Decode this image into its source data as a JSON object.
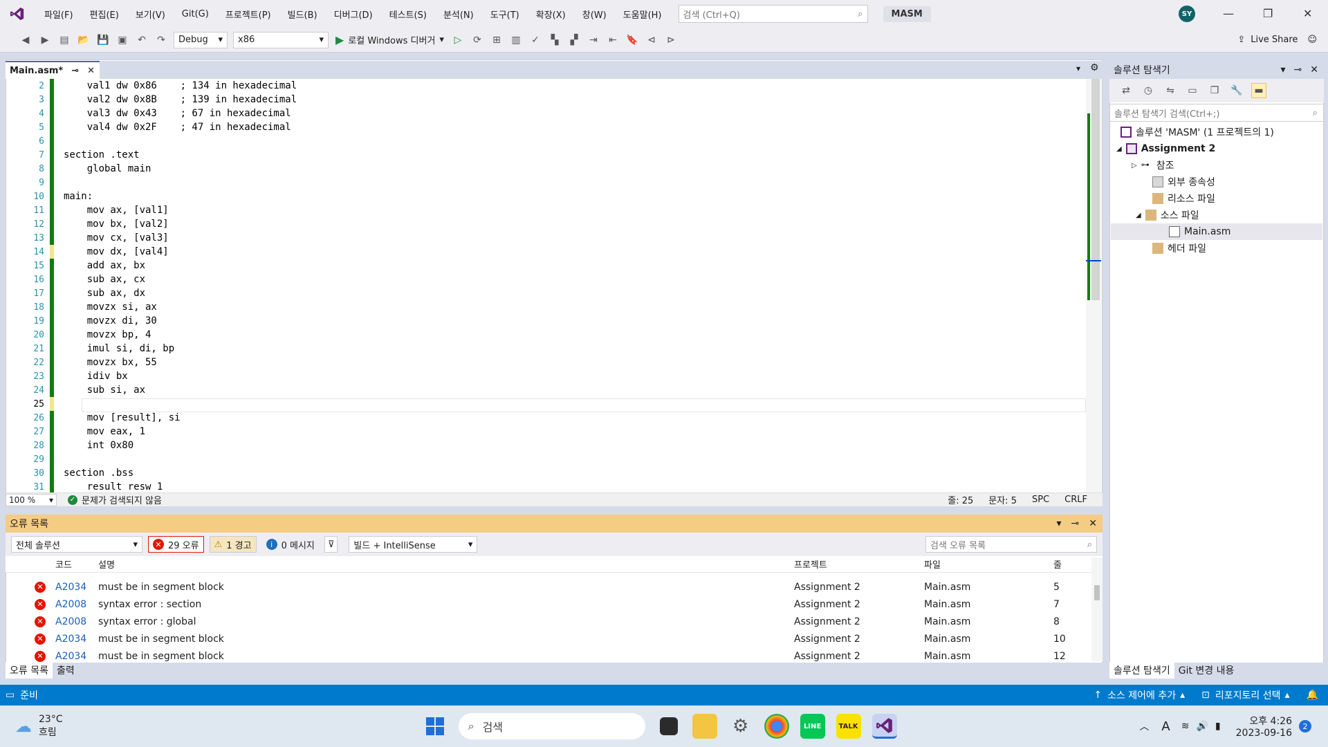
{
  "menu": [
    "파일(F)",
    "편집(E)",
    "보기(V)",
    "Git(G)",
    "프로젝트(P)",
    "빌드(B)",
    "디버그(D)",
    "테스트(S)",
    "분석(N)",
    "도구(T)",
    "확장(X)",
    "창(W)",
    "도움말(H)"
  ],
  "top_search_placeholder": "검색 (Ctrl+Q)",
  "solution_name": "MASM",
  "user_initials": "SY",
  "toolbar": {
    "config": "Debug",
    "platform": "x86",
    "run_label": "로컬 Windows 디버거",
    "live_share": "Live Share"
  },
  "doc_tab": "Main.asm*",
  "code_lines": [
    {
      "n": "2",
      "text": "    val1 dw 0x86    ; 134 in hexadecimal"
    },
    {
      "n": "3",
      "text": "    val2 dw 0x8B    ; 139 in hexadecimal"
    },
    {
      "n": "4",
      "text": "    val3 dw 0x43    ; 67 in hexadecimal"
    },
    {
      "n": "5",
      "text": "    val4 dw 0x2F    ; 47 in hexadecimal"
    },
    {
      "n": "6",
      "text": ""
    },
    {
      "n": "7",
      "text": "section .text"
    },
    {
      "n": "8",
      "text": "    global main"
    },
    {
      "n": "9",
      "text": ""
    },
    {
      "n": "10",
      "text": "main:"
    },
    {
      "n": "11",
      "text": "    mov ax, [val1]"
    },
    {
      "n": "12",
      "text": "    mov bx, [val2]"
    },
    {
      "n": "13",
      "text": "    mov cx, [val3]"
    },
    {
      "n": "14",
      "text": "    mov dx, [val4]"
    },
    {
      "n": "15",
      "text": "    add ax, bx"
    },
    {
      "n": "16",
      "text": "    sub ax, cx"
    },
    {
      "n": "17",
      "text": "    sub ax, dx"
    },
    {
      "n": "18",
      "text": "    movzx si, ax"
    },
    {
      "n": "19",
      "text": "    movzx di, 30"
    },
    {
      "n": "20",
      "text": "    movzx bp, 4"
    },
    {
      "n": "21",
      "text": "    imul si, di, bp"
    },
    {
      "n": "22",
      "text": "    movzx bx, 55"
    },
    {
      "n": "23",
      "text": "    idiv bx"
    },
    {
      "n": "24",
      "text": "    sub si, ax"
    },
    {
      "n": "25",
      "text": ""
    },
    {
      "n": "26",
      "text": "    mov [result], si"
    },
    {
      "n": "27",
      "text": "    mov eax, 1"
    },
    {
      "n": "28",
      "text": "    int 0x80"
    },
    {
      "n": "29",
      "text": ""
    },
    {
      "n": "30",
      "text": "section .bss"
    },
    {
      "n": "31",
      "text": "    result resw 1"
    }
  ],
  "editor_status": {
    "zoom": "100 %",
    "issues": "문제가 검색되지 않음",
    "line": "줄: 25",
    "col": "문자: 5",
    "spc": "SPC",
    "eol": "CRLF"
  },
  "error_list": {
    "title": "오류 목록",
    "scope": "전체 솔루션",
    "errors": "29 오류",
    "warnings": "1 경고",
    "messages": "0 메시지",
    "source": "빌드 + IntelliSense",
    "search_placeholder": "검색 오류 목록",
    "headers": {
      "code": "코드",
      "desc": "설명",
      "project": "프로젝트",
      "file": "파일",
      "line": "줄"
    },
    "rows": [
      {
        "code": "A2034",
        "desc": "must be in segment block",
        "project": "Assignment 2",
        "file": "Main.asm",
        "line": "5"
      },
      {
        "code": "A2008",
        "desc": "syntax error : section",
        "project": "Assignment 2",
        "file": "Main.asm",
        "line": "7"
      },
      {
        "code": "A2008",
        "desc": "syntax error : global",
        "project": "Assignment 2",
        "file": "Main.asm",
        "line": "8"
      },
      {
        "code": "A2034",
        "desc": "must be in segment block",
        "project": "Assignment 2",
        "file": "Main.asm",
        "line": "10"
      },
      {
        "code": "A2034",
        "desc": "must be in segment block",
        "project": "Assignment 2",
        "file": "Main.asm",
        "line": "12"
      }
    ],
    "tabs": [
      "오류 목록",
      "출력"
    ]
  },
  "solution_explorer": {
    "title": "솔루션 탐색기",
    "search_placeholder": "솔루션 탐색기 검색(Ctrl+;)",
    "tree": {
      "solution": "솔루션 'MASM' (1 프로젝트의 1)",
      "project": "Assignment 2",
      "refs": "참조",
      "external": "외부 종속성",
      "resources": "리소스 파일",
      "sources": "소스 파일",
      "main": "Main.asm",
      "headers": "헤더 파일"
    },
    "tabs": [
      "솔루션 탐색기",
      "Git 변경 내용"
    ]
  },
  "statusbar": {
    "ready": "준비",
    "add_source": "소스 제어에 추가",
    "repo": "리포지토리 선택"
  },
  "taskbar": {
    "temp": "23°C",
    "weather": "흐림",
    "search": "검색",
    "time": "오후 4:26",
    "date": "2023-09-16",
    "notif": "2"
  },
  "colors": {
    "accent": "#007acc",
    "error": "#e51400",
    "warning": "#f5cc84",
    "vs_purple": "#68217a"
  }
}
